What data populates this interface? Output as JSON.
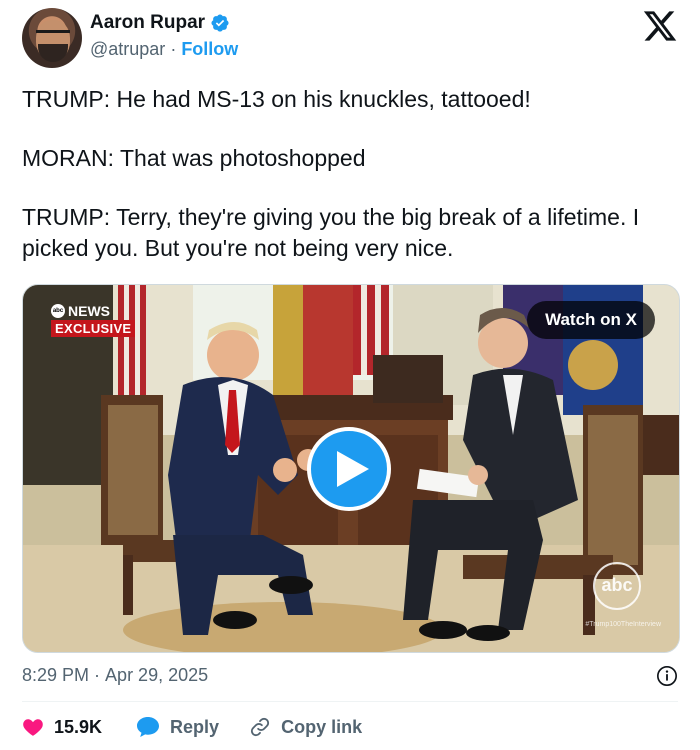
{
  "author": {
    "name": "Aaron Rupar",
    "handle": "@atrupar",
    "separator": "·",
    "follow_label": "Follow",
    "verified": true
  },
  "platform_logo": "x-logo-icon",
  "tweet": {
    "paragraphs": [
      "TRUMP: He had MS-13 on his knuckles, tattooed!",
      "MORAN: That was photoshopped",
      "TRUMP: Terry, they're giving you the big break of a lifetime. I picked you. But you're not being very nice."
    ]
  },
  "media": {
    "badge_network": "NEWS",
    "badge_exclusive": "EXCLUSIVE",
    "watch_label": "Watch on X",
    "watermark_logo": "abc",
    "watermark_hashtag": "#Trump100TheInterview",
    "play_icon": "play-icon"
  },
  "meta": {
    "time": "8:29 PM",
    "separator": "·",
    "date": "Apr 29, 2025"
  },
  "actions": {
    "likes": "15.9K",
    "reply_label": "Reply",
    "copy_label": "Copy link"
  },
  "colors": {
    "accent": "#1d9bf0",
    "like": "#f91880",
    "text": "#0f1419",
    "secondary": "#536471"
  }
}
